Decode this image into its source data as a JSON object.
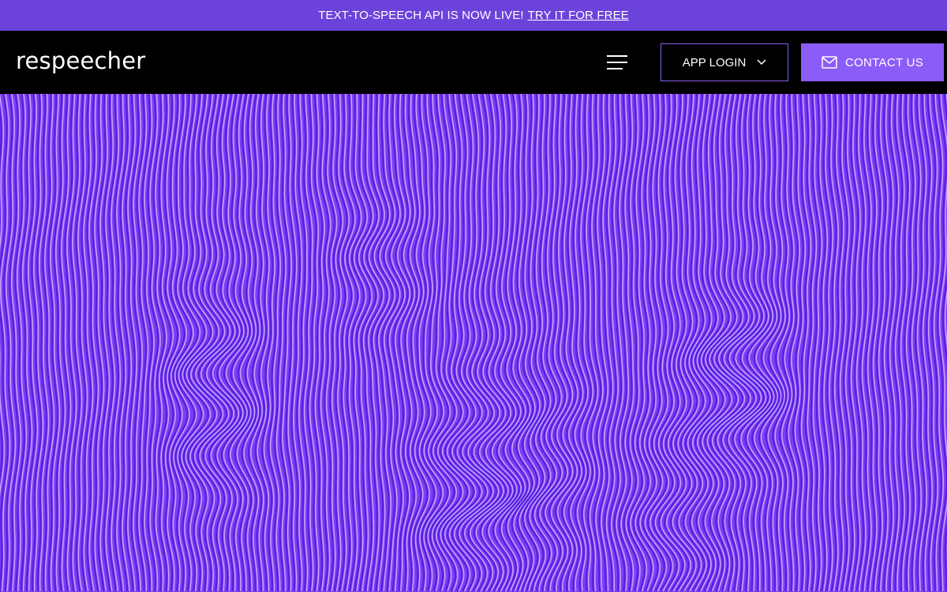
{
  "announcement": {
    "text": "TEXT-TO-SPEECH API IS NOW LIVE!",
    "link": "TRY IT FOR FREE"
  },
  "header": {
    "logo": "respeecher",
    "app_login": "APP LOGIN",
    "contact": "CONTACT US"
  },
  "colors": {
    "announce_bg": "#6b43db",
    "nav_bg": "#000000",
    "accent": "#8c5cf7",
    "hero_base": "#7a40f2"
  },
  "icons": {
    "menu": "hamburger-menu-icon",
    "chevron": "chevron-down-icon",
    "mail": "mail-icon"
  }
}
